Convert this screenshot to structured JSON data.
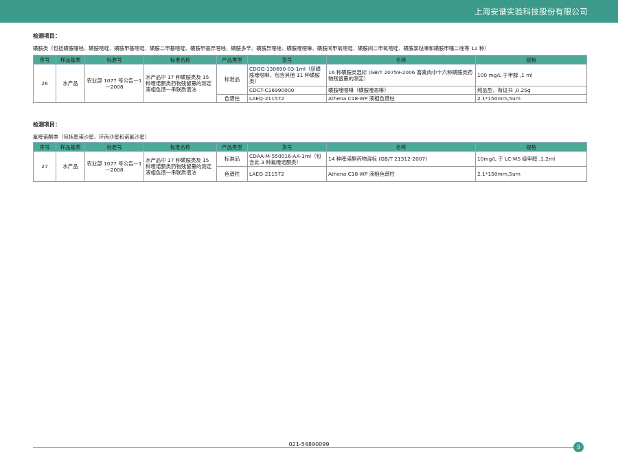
{
  "header": {
    "company": "上海安谱实验科技股份有限公司"
  },
  "columns": [
    "序号",
    "样品基质",
    "标准号",
    "标准名称",
    "产品类型",
    "货号",
    "名称",
    "规格"
  ],
  "sections": [
    {
      "title": "检测项目：",
      "desc": "磺胺类（包括磺胺噻唑、磺胺嘧啶、磺胺甲基嘧啶、磺胺二甲基嘧啶、磺胺甲基异噁唑、磺胺多辛、磺胺异噁唑、磺胺喹噁啉、磺胺间甲氧嘧啶、磺胺间二甲氧嘧啶、磺胺氯哒嗪和磺胺甲噻二唑等 12 种）",
      "no": "26",
      "matrix": "水产品",
      "std_no": "农业部 1077 号公告—1—2008",
      "std_name": "水产品中 17 种磺胺类及 15 种喹诺酮类药物残留量的测定 液相色谱—串联质谱法",
      "rows": [
        {
          "type": "标准品",
          "code": "CDGG-130690-03-1ml（获磺胺喹噁啉，包含其他 11 种磺胺类）",
          "name": "16 种磺胺类混标 (GB/T 20759-2006 畜禽肉中十六种磺胺类药物残留量的测定）",
          "spec": "100 mg/L 于甲醇 ,1 ml"
        },
        {
          "type": "",
          "code": "CDCT-C16990000",
          "name": "磺胺喹噁啉（磺胺喹恶啉）",
          "spec": "纯品型，有证书 ,0.25g"
        },
        {
          "type": "色谱柱",
          "code": "LAEQ-211572",
          "name": "Athena C18-WP 液相色谱柱",
          "spec": "2.1*150mm,5um"
        }
      ]
    },
    {
      "title": "检测项目：",
      "desc": "氟喹诺酮类（包括恩诺沙星、环丙沙星和诺氟沙星）",
      "no": "27",
      "matrix": "水产品",
      "std_no": "农业部 1077 号公告—1—2008",
      "std_name": "水产品中 17 种磺胺类及 15 种喹诺酮类药物残留量的测定 液相色谱—串联质谱法",
      "rows": [
        {
          "type": "标准品",
          "code": "CDAA-M-550016-AA-1ml（包含此 3 种氟喹诺酮类）",
          "name": "14 种喹诺酮药物混标 (GB/T 21312-2007)",
          "spec": "10mg/L 于 LC-MS 级甲醇 ,1.2ml"
        },
        {
          "type": "色谱柱",
          "code": "LAEQ-211572",
          "name": "Athena C18-WP 液相色谱柱",
          "spec": "2.1*150mm,5um"
        }
      ]
    }
  ],
  "footer": {
    "phone": "021-54890099",
    "page": "9"
  }
}
